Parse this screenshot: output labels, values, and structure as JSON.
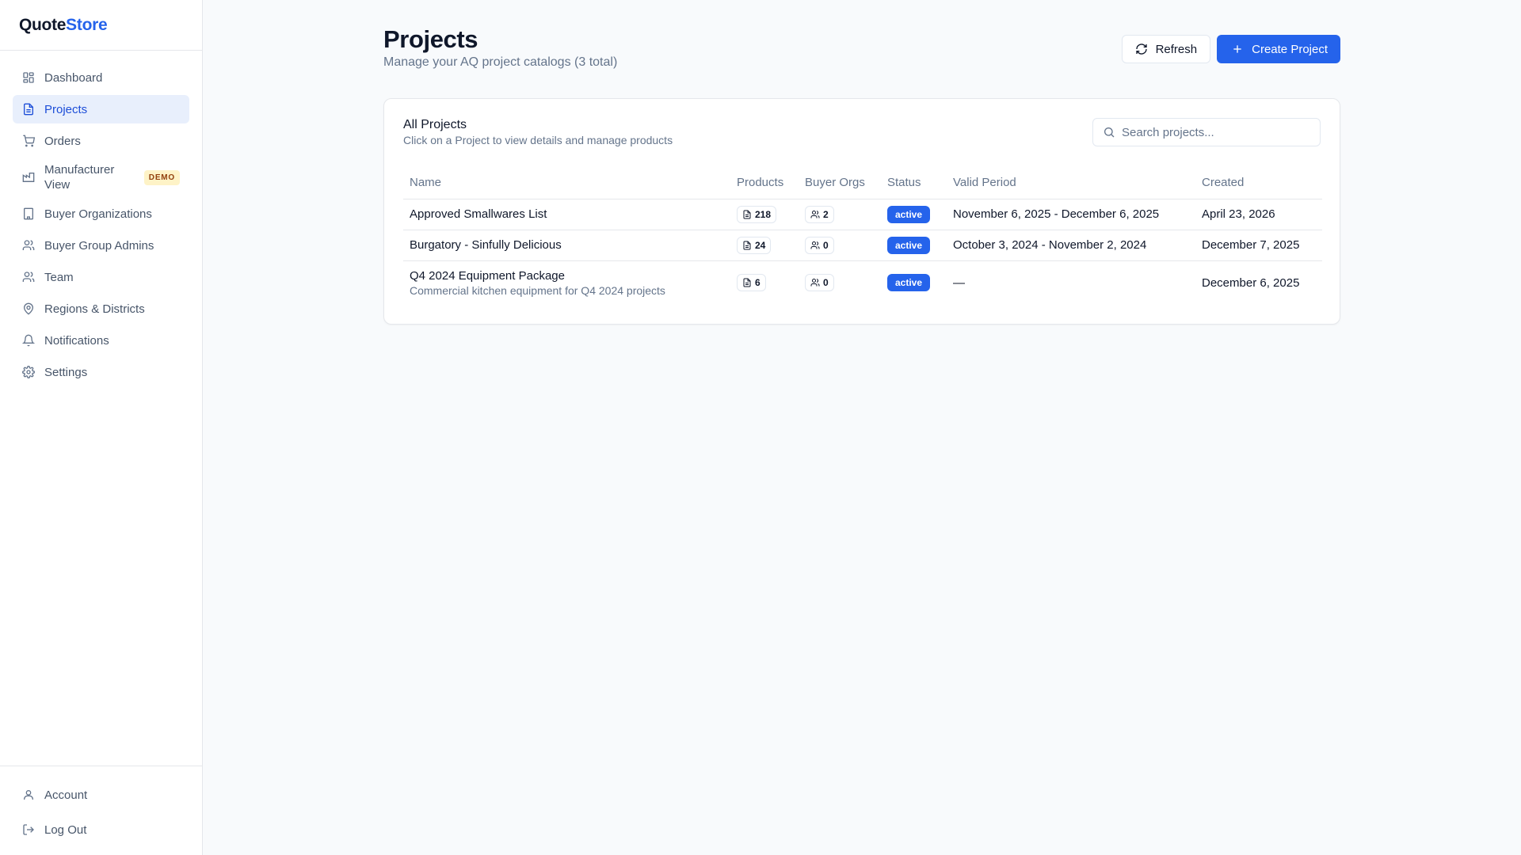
{
  "brand": {
    "part1": "Quote",
    "part2": "Store"
  },
  "sidebar": {
    "items": [
      {
        "label": "Dashboard",
        "icon": "dashboard-icon"
      },
      {
        "label": "Projects",
        "icon": "file-text-icon",
        "active": true
      },
      {
        "label": "Orders",
        "icon": "cart-icon"
      },
      {
        "label": "Manufacturer View",
        "icon": "factory-icon",
        "badge": "DEMO"
      },
      {
        "label": "Buyer Organizations",
        "icon": "building-icon"
      },
      {
        "label": "Buyer Group Admins",
        "icon": "users-icon"
      },
      {
        "label": "Team",
        "icon": "team-icon"
      },
      {
        "label": "Regions & Districts",
        "icon": "map-pin-icon"
      },
      {
        "label": "Notifications",
        "icon": "bell-icon"
      },
      {
        "label": "Settings",
        "icon": "gear-icon"
      }
    ],
    "bottom": [
      {
        "label": "Account",
        "icon": "user-icon"
      },
      {
        "label": "Log Out",
        "icon": "logout-icon"
      }
    ]
  },
  "header": {
    "title": "Projects",
    "subtitle": "Manage your AQ project catalogs (3 total)",
    "refresh_label": "Refresh",
    "create_label": "Create Project"
  },
  "card": {
    "title": "All Projects",
    "description": "Click on a Project to view details and manage products",
    "search_placeholder": "Search projects..."
  },
  "table": {
    "columns": [
      "Name",
      "Products",
      "Buyer Orgs",
      "Status",
      "Valid Period",
      "Created"
    ],
    "rows": [
      {
        "name": "Approved Smallwares List",
        "description": "",
        "products": "218",
        "buyer_orgs": "2",
        "status": "active",
        "valid_period": "November 6, 2025 - December 6, 2025",
        "created": "April 23, 2026"
      },
      {
        "name": "Burgatory - Sinfully Delicious",
        "description": "",
        "products": "24",
        "buyer_orgs": "0",
        "status": "active",
        "valid_period": "October 3, 2024 - November 2, 2024",
        "created": "December 7, 2025"
      },
      {
        "name": "Q4 2024 Equipment Package",
        "description": "Commercial kitchen equipment for Q4 2024 projects",
        "products": "6",
        "buyer_orgs": "0",
        "status": "active",
        "valid_period": "—",
        "created": "December 6, 2025"
      }
    ]
  },
  "colors": {
    "accent": "#2563eb",
    "active_nav_bg": "#e8effc",
    "demo_badge_bg": "#fef3c7",
    "demo_badge_text": "#92400e"
  }
}
